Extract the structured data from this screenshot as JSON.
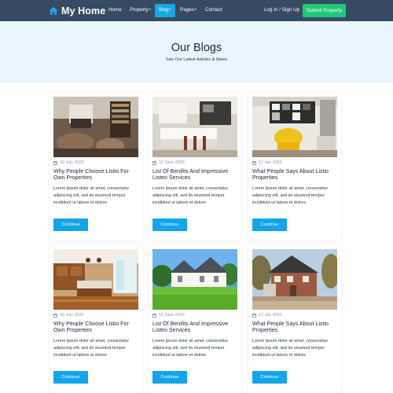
{
  "navbar": {
    "brand": "My Home",
    "links": [
      "Home",
      "Property",
      "Blog",
      "Pages",
      "Contact"
    ],
    "login": "Log In / Sign Up",
    "submit": "Submit Property",
    "accent": "#17a8e3",
    "bg": "#364a63",
    "submit_color": "#21c87a"
  },
  "hero": {
    "title": "Our Blogs",
    "subtitle": "See Our Latest Articles & News"
  },
  "cards": [
    {
      "date": "10 July 2020",
      "title": "Why People Choose Listio For Own Properties",
      "excerpt": "Lorem Ipsum dolor sit amet, consectetur adipiscing elit, sed do eiusmod tempor incididunt ut labore et dolore.",
      "button": "Continue",
      "image": "living-room-photo"
    },
    {
      "date": "12 June 2020",
      "title": "List Of Benifits And Impressive Listeo Services",
      "excerpt": "Lorem Ipsum dolor sit amet, consectetur adipiscing elit, sed do eiusmod tempor incididunt ut labore et dolore.",
      "button": "Continue",
      "image": "kitchen-photo"
    },
    {
      "date": "17 Jan 2020",
      "title": "What People Says About Listio Properties",
      "excerpt": "Lorem Ipsum dolor sit amet, consectetur adipiscing elit, sed do eiusmod tempor incididunt ut labore et dolore.",
      "button": "Continue",
      "image": "yellow-chair-room-photo"
    },
    {
      "date": "10 July 2020",
      "title": "Why People Choose Listio For Own Properties",
      "excerpt": "Lorem Ipsum dolor sit amet, consectetur adipiscing elit, sed do eiusmod tempor incididunt ut labore et dolore.",
      "button": "Continue",
      "image": "wood-kitchen-photo"
    },
    {
      "date": "12 June 2020",
      "title": "List Of Benifits And Impressive Listeo Services",
      "excerpt": "Lorem Ipsum dolor sit amet, consectetur adipiscing elit, sed do eiusmod tempor incididunt ut labore et dolore.",
      "button": "Continue",
      "image": "white-house-photo"
    },
    {
      "date": "17 Jan 2020",
      "title": "What People Says About Listio Properties",
      "excerpt": "Lorem Ipsum dolor sit amet, consectetur adipiscing elit, sed do eiusmod tempor incididunt ut labore et dolore.",
      "button": "Continue",
      "image": "brick-house-photo"
    }
  ]
}
